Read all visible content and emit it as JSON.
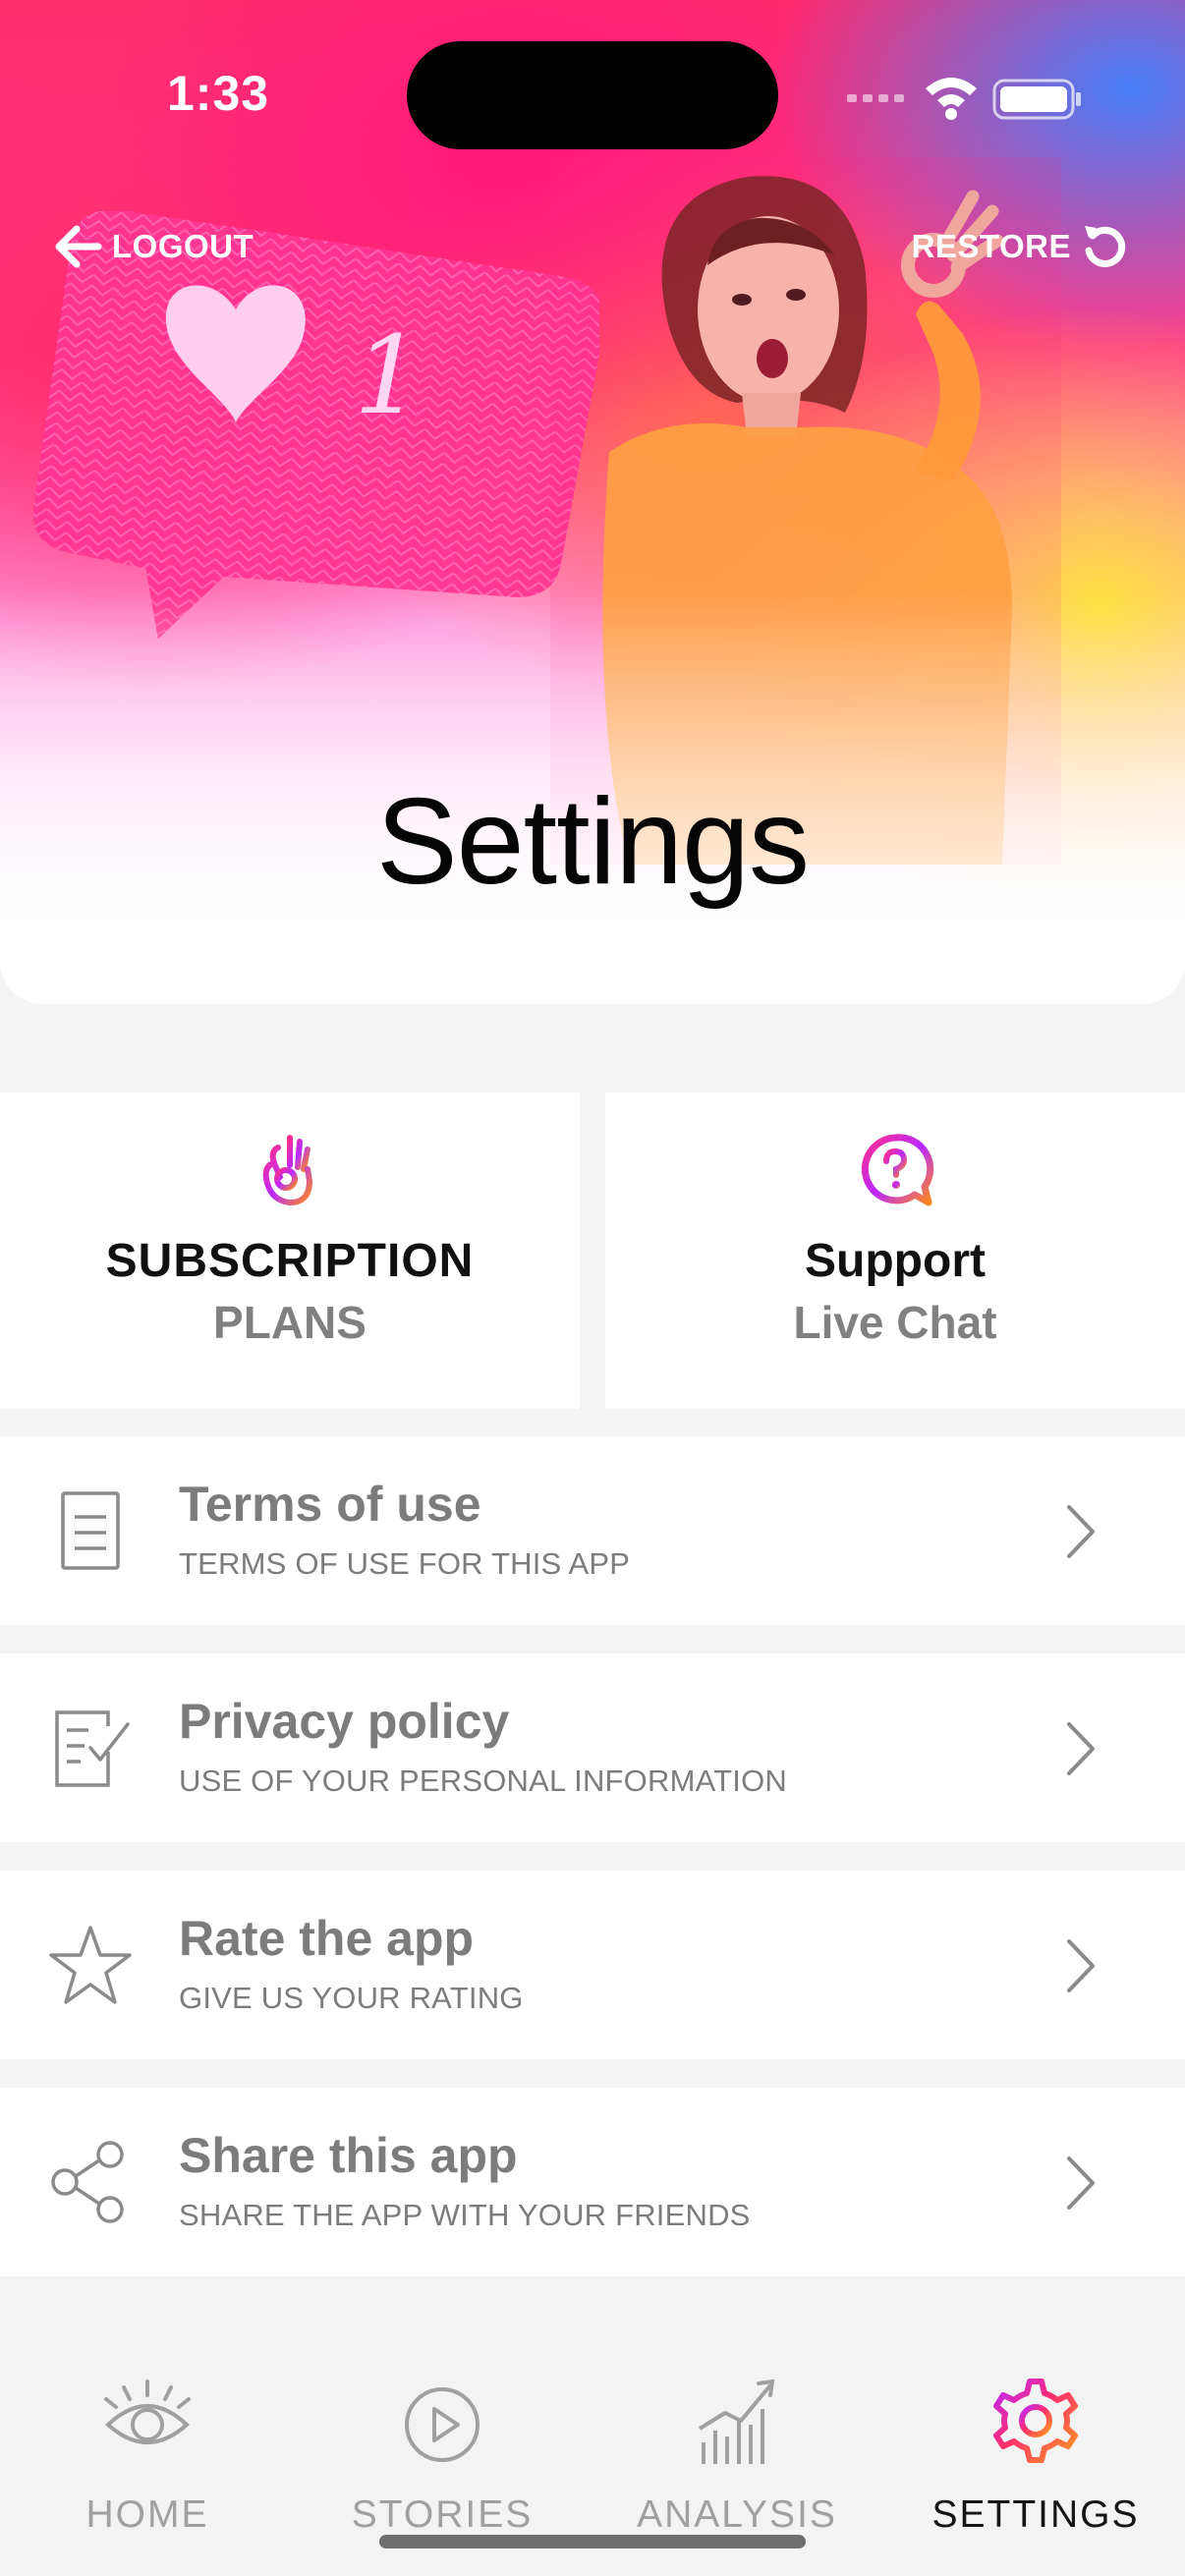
{
  "status_bar": {
    "time": "1:33"
  },
  "header": {
    "logout_label": "LOGOUT",
    "restore_label": "RESTORE",
    "title": "Settings"
  },
  "cards": [
    {
      "title": "SUBSCRIPTION",
      "subtitle": "PLANS",
      "icon": "ok-hand-icon"
    },
    {
      "title": "Support",
      "subtitle": "Live Chat",
      "icon": "help-chat-icon"
    }
  ],
  "menu": [
    {
      "title": "Terms of use",
      "subtitle": "TERMS OF USE FOR THIS APP",
      "icon": "document-icon"
    },
    {
      "title": "Privacy policy",
      "subtitle": "USE OF YOUR PERSONAL INFORMATION",
      "icon": "checklist-icon"
    },
    {
      "title": "Rate the app",
      "subtitle": "GIVE US YOUR RATING",
      "icon": "star-icon"
    },
    {
      "title": "Share this app",
      "subtitle": "SHARE THE APP WITH YOUR FRIENDS",
      "icon": "share-icon"
    }
  ],
  "tabs": [
    {
      "label": "HOME",
      "icon": "eye-icon",
      "active": false
    },
    {
      "label": "STORIES",
      "icon": "play-circle-icon",
      "active": false
    },
    {
      "label": "ANALYSIS",
      "icon": "bar-chart-icon",
      "active": false
    },
    {
      "label": "SETTINGS",
      "icon": "gear-icon",
      "active": true
    }
  ],
  "colors": {
    "accent_gradient": [
      "#ff2d6e",
      "#c22cff",
      "#ff9a2e"
    ],
    "text_muted": "#7c7c7c",
    "tab_inactive": "#a0a0a0",
    "tab_active": "#151515"
  }
}
